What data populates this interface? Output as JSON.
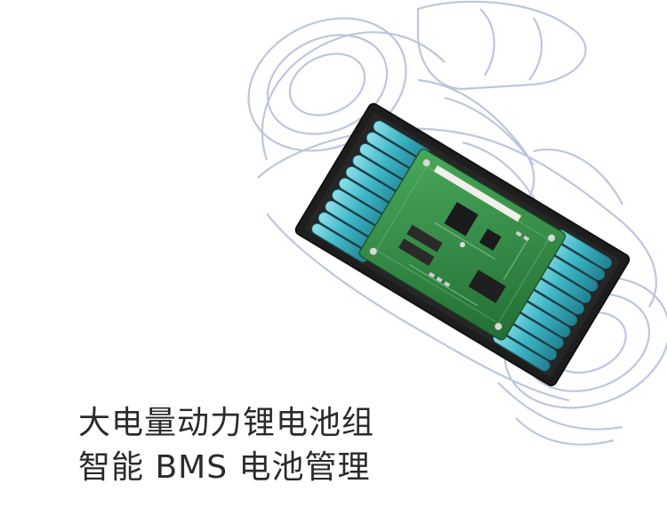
{
  "caption": {
    "line1": "大电量动力锂电池组",
    "line2": "智能 BMS 电池管理"
  },
  "colors": {
    "background": "#ffffff",
    "ghost_body": "#a9b4cf",
    "battery_cell": "#3fb6c6",
    "pcb": "#2f8a45",
    "tray": "#1d1d1d",
    "text": "#2a2a2a"
  },
  "icons": {
    "illustration": "hoverboard-xray-battery-illustration"
  }
}
